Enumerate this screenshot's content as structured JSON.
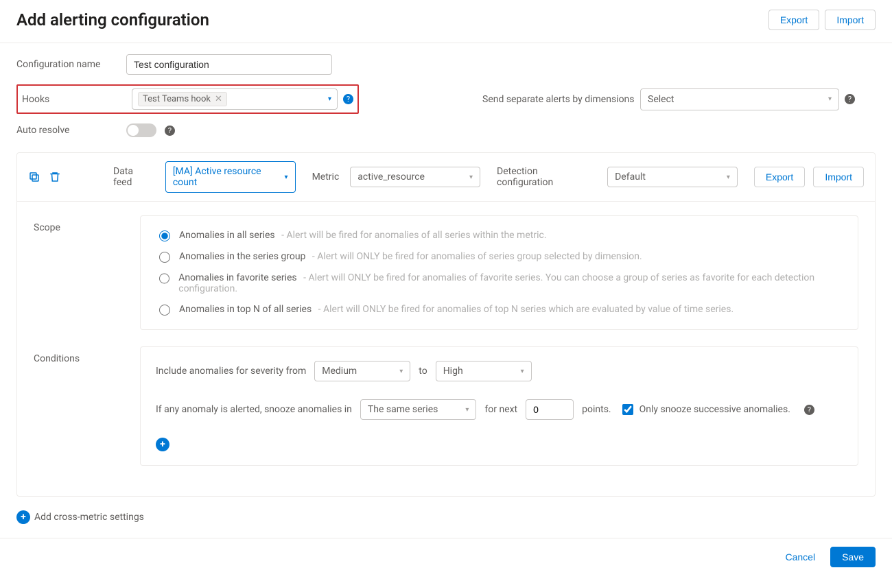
{
  "header": {
    "title": "Add alerting configuration",
    "export": "Export",
    "import": "Import"
  },
  "config": {
    "name_label": "Configuration name",
    "name_value": "Test configuration",
    "hooks_label": "Hooks",
    "hook_chip": "Test Teams hook",
    "dim_label": "Send separate alerts by dimensions",
    "dim_placeholder": "Select",
    "auto_label": "Auto resolve"
  },
  "panel": {
    "feed_label": "Data feed",
    "feed_value": "[MA] Active resource count",
    "metric_label": "Metric",
    "metric_value": "active_resource",
    "detect_label": "Detection configuration",
    "detect_value": "Default",
    "export": "Export",
    "import": "Import"
  },
  "scope": {
    "label": "Scope",
    "options": [
      {
        "title": "Anomalies in all series",
        "desc": "- Alert will be fired for anomalies of all series within the metric."
      },
      {
        "title": "Anomalies in the series group",
        "desc": "- Alert will ONLY be fired for anomalies of series group selected by dimension."
      },
      {
        "title": "Anomalies in favorite series",
        "desc": "- Alert will ONLY be fired for anomalies of favorite series. You can choose a group of series as favorite for each detection configuration."
      },
      {
        "title": "Anomalies in top N of all series",
        "desc": "- Alert will ONLY be fired for anomalies of top N series which are evaluated by value of time series."
      }
    ]
  },
  "conditions": {
    "label": "Conditions",
    "severity_prefix": "Include anomalies for severity from",
    "severity_from": "Medium",
    "severity_to_label": "to",
    "severity_to": "High",
    "snooze_prefix": "If any anomaly is alerted, snooze anomalies in",
    "snooze_scope": "The same series",
    "snooze_mid": "for next",
    "snooze_value": "0",
    "snooze_suffix": "points.",
    "snooze_cb": "Only snooze successive anomalies."
  },
  "cross_metric": "Add cross-metric settings",
  "footer": {
    "cancel": "Cancel",
    "save": "Save"
  }
}
